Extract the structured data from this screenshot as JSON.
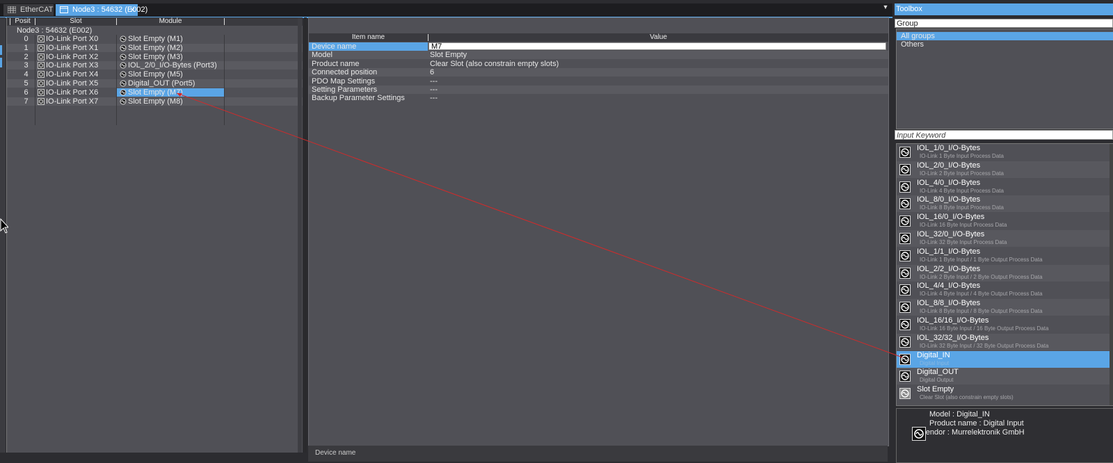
{
  "tabs": {
    "ethercat": "EtherCAT",
    "node": "Node3 : 54632 (E002)",
    "close": "×"
  },
  "slot_table": {
    "headers": {
      "position": "Posit",
      "slot": "Slot",
      "module": "Module"
    },
    "node_label": "Node3 : 54632 (E002)",
    "rows": [
      {
        "pos": "0",
        "slot": "IO-Link Port X0",
        "module": "Slot Empty (M1)"
      },
      {
        "pos": "1",
        "slot": "IO-Link Port X1",
        "module": "Slot Empty (M2)"
      },
      {
        "pos": "2",
        "slot": "IO-Link Port X2",
        "module": "Slot Empty (M3)"
      },
      {
        "pos": "3",
        "slot": "IO-Link Port X3",
        "module": "IOL_2/0_I/O-Bytes (Port3)"
      },
      {
        "pos": "4",
        "slot": "IO-Link Port X4",
        "module": "Slot Empty (M5)"
      },
      {
        "pos": "5",
        "slot": "IO-Link Port X5",
        "module": "Digital_OUT (Port5)"
      },
      {
        "pos": "6",
        "slot": "IO-Link Port X6",
        "module": "Slot Empty (M7)"
      },
      {
        "pos": "7",
        "slot": "IO-Link Port X7",
        "module": "Slot Empty (M8)"
      }
    ],
    "selected_row": 6
  },
  "properties": {
    "headers": {
      "item": "Item name",
      "value": "Value"
    },
    "rows": [
      {
        "item": "Device name",
        "value": "M7"
      },
      {
        "item": "Model",
        "value": "Slot Empty"
      },
      {
        "item": "Product name",
        "value": "Clear Slot (also constrain empty slots)"
      },
      {
        "item": "Connected position",
        "value": "6"
      },
      {
        "item": "PDO Map Settings",
        "value": "---"
      },
      {
        "item": "Setting Parameters",
        "value": "---"
      },
      {
        "item": "Backup Parameter Settings",
        "value": "---"
      }
    ],
    "bottom_label": "Device name"
  },
  "toolbox": {
    "title": "Toolbox",
    "group_label": "Group",
    "groups": [
      "All groups",
      "Others"
    ],
    "keyword_placeholder": "Input Keyword",
    "modules": [
      {
        "name": "IOL_1/0_I/O-Bytes",
        "desc": "IO-Link 1 Byte Input Process Data"
      },
      {
        "name": "IOL_2/0_I/O-Bytes",
        "desc": "IO-Link 2 Byte Input Process Data"
      },
      {
        "name": "IOL_4/0_I/O-Bytes",
        "desc": "IO-Link 4 Byte Input Process Data"
      },
      {
        "name": "IOL_8/0_I/O-Bytes",
        "desc": "IO-Link 8 Byte Input Process Data"
      },
      {
        "name": "IOL_16/0_I/O-Bytes",
        "desc": "IO-Link 16 Byte Input Process Data"
      },
      {
        "name": "IOL_32/0_I/O-Bytes",
        "desc": "IO-Link 32 Byte Input Process Data"
      },
      {
        "name": "IOL_1/1_I/O-Bytes",
        "desc": "IO-Link 1 Byte Input / 1 Byte Output Process Data"
      },
      {
        "name": "IOL_2/2_I/O-Bytes",
        "desc": "IO-Link 2 Byte Input / 2 Byte Output Process Data"
      },
      {
        "name": "IOL_4/4_I/O-Bytes",
        "desc": "IO-Link 4 Byte Input / 4 Byte Output Process Data"
      },
      {
        "name": "IOL_8/8_I/O-Bytes",
        "desc": "IO-Link 8 Byte Input / 8 Byte Output Process Data"
      },
      {
        "name": "IOL_16/16_I/O-Bytes",
        "desc": "IO-Link 16 Byte Input / 16 Byte Output Process Data"
      },
      {
        "name": "IOL_32/32_I/O-Bytes",
        "desc": "IO-Link 32 Byte Input / 32 Byte Output Process Data"
      },
      {
        "name": "Digital_IN",
        "desc": "Digital Input"
      },
      {
        "name": "Digital_OUT",
        "desc": "Digital Output"
      },
      {
        "name": "Slot Empty",
        "desc": "Clear Slot (also constrain empty slots)"
      }
    ],
    "selected_module": 12,
    "info": {
      "model": "Model : Digital_IN",
      "product": "Product name : Digital Input",
      "vendor": "Vendor :  Murrelektronik GmbH"
    }
  },
  "colors": {
    "accent": "#5aa5e6",
    "panel": "#505056",
    "background": "#2c2c30",
    "drag_line": "#d22a2a"
  },
  "icons": [
    "grid-icon",
    "module-icon",
    "slot-icon",
    "dropdown-arrow-icon",
    "cursor-icon"
  ]
}
